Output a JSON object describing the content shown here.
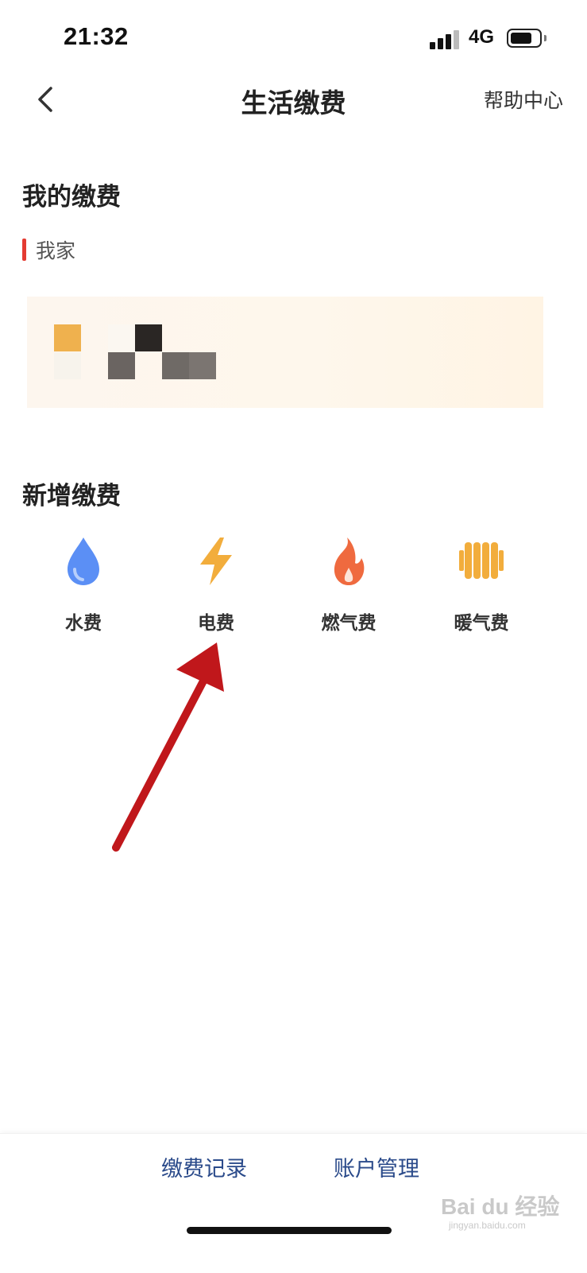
{
  "status_bar": {
    "time": "21:32",
    "network": "4G",
    "signal_bars": 4,
    "battery_level": 0.75
  },
  "header": {
    "title": "生活缴费",
    "help_label": "帮助中心",
    "back_icon": "chevron-left-icon"
  },
  "my_bills": {
    "title": "我的缴费",
    "family_label": "我家"
  },
  "add_bill": {
    "title": "新增缴费",
    "services": [
      {
        "label": "水费",
        "icon": "water-drop-icon",
        "color": "#5b8ff5"
      },
      {
        "label": "电费",
        "icon": "lightning-icon",
        "color": "#f2ad3c"
      },
      {
        "label": "燃气费",
        "icon": "flame-icon",
        "color": "#ef6a3f"
      },
      {
        "label": "暖气费",
        "icon": "radiator-icon",
        "color": "#f2ad3c"
      }
    ]
  },
  "bottom_bar": {
    "records_label": "缴费记录",
    "account_label": "账户管理"
  },
  "watermark": {
    "text": "Bai du 经验",
    "sub": "jingyan.baidu.com"
  },
  "colors": {
    "accent_red": "#e43b32",
    "link_blue": "#2a4a8a",
    "annotation_arrow": "#c0171b"
  }
}
